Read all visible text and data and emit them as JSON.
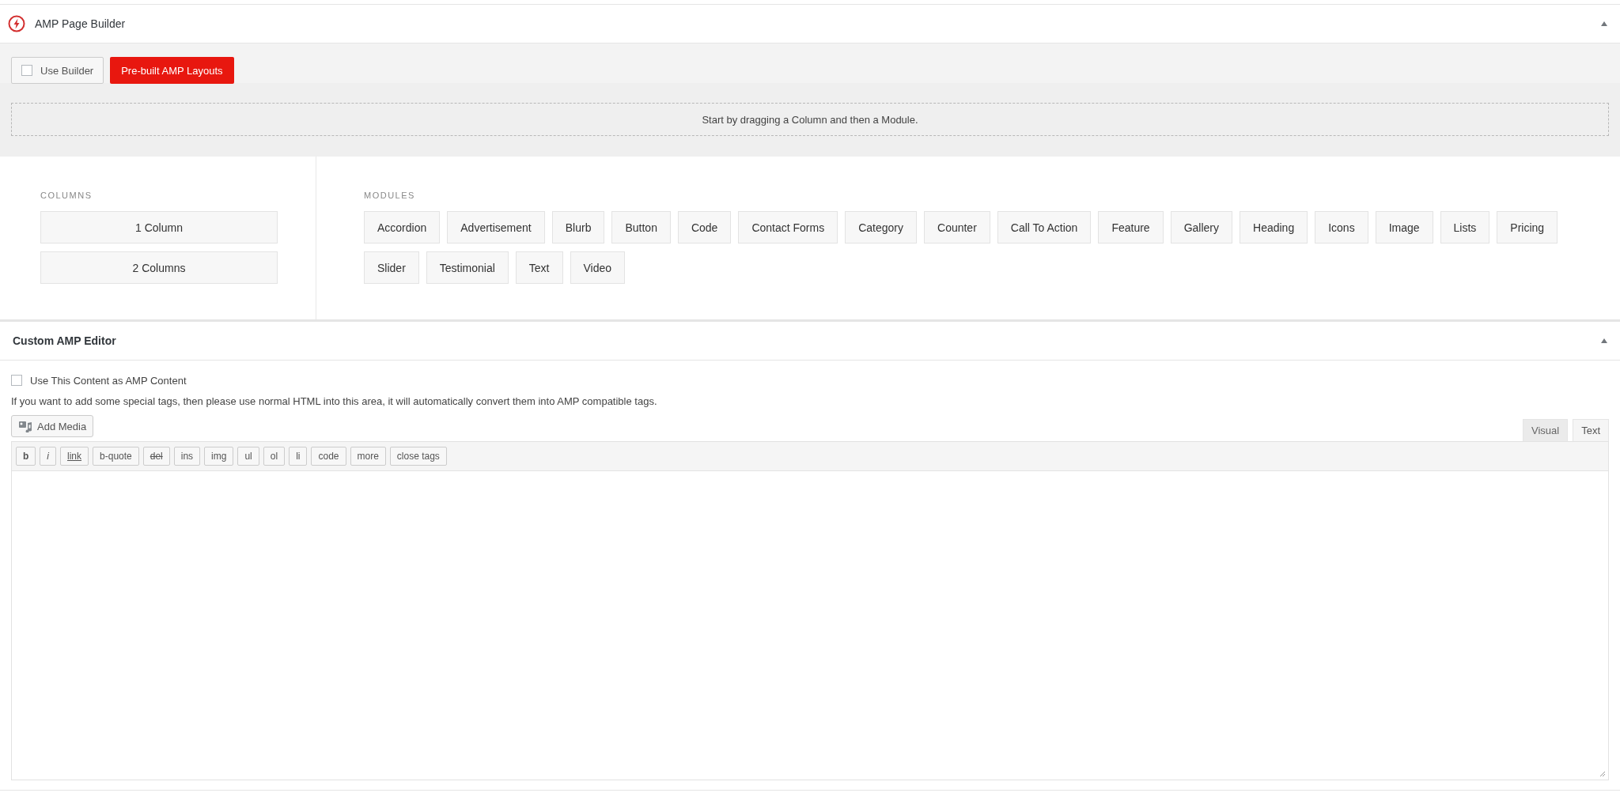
{
  "builder_panel": {
    "title": "AMP Page Builder",
    "collapsed": false,
    "use_builder": {
      "label": "Use Builder",
      "checked": false
    },
    "layouts_button": "Pre-built AMP Layouts",
    "dropzone_hint": "Start by dragging a Column and then a Module.",
    "columns_heading": "COLUMNS",
    "columns": [
      "1 Column",
      "2 Columns"
    ],
    "modules_heading": "MODULES",
    "modules": [
      "Accordion",
      "Advertisement",
      "Blurb",
      "Button",
      "Code",
      "Contact Forms",
      "Category",
      "Counter",
      "Call To Action",
      "Feature",
      "Gallery",
      "Heading",
      "Icons",
      "Image",
      "Lists",
      "Pricing",
      "Slider",
      "Testimonial",
      "Text",
      "Video"
    ]
  },
  "editor_panel": {
    "title": "Custom AMP Editor",
    "collapsed": false,
    "use_content": {
      "label": "Use This Content as AMP Content",
      "checked": false
    },
    "description": "If you want to add some special tags, then please use normal HTML into this area, it will automatically convert them into AMP compatible tags.",
    "add_media": "Add Media",
    "tabs": [
      {
        "label": "Visual",
        "selected": false
      },
      {
        "label": "Text",
        "selected": true
      }
    ],
    "quicktags": [
      {
        "label": "b",
        "kind": "bold"
      },
      {
        "label": "i",
        "kind": "italic"
      },
      {
        "label": "link",
        "kind": "link"
      },
      {
        "label": "b-quote",
        "kind": "plain"
      },
      {
        "label": "del",
        "kind": "strike"
      },
      {
        "label": "ins",
        "kind": "plain"
      },
      {
        "label": "img",
        "kind": "plain"
      },
      {
        "label": "ul",
        "kind": "plain"
      },
      {
        "label": "ol",
        "kind": "plain"
      },
      {
        "label": "li",
        "kind": "plain"
      },
      {
        "label": "code",
        "kind": "plain"
      },
      {
        "label": "more",
        "kind": "plain"
      },
      {
        "label": "close tags",
        "kind": "plain"
      }
    ]
  }
}
